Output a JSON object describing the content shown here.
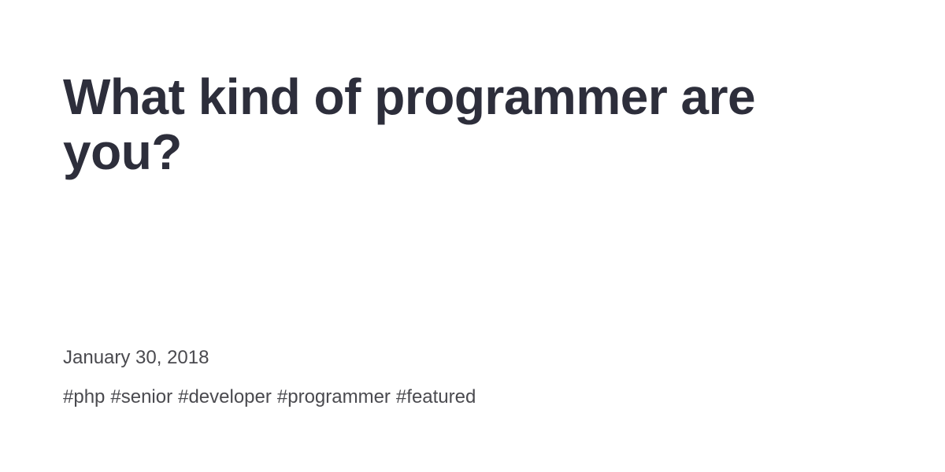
{
  "post": {
    "title": "What kind of programmer are you?",
    "date": "January 30, 2018",
    "tags": [
      "#php",
      "#senior",
      "#developer",
      "#programmer",
      "#featured"
    ]
  },
  "colors": {
    "background": "#ffffff",
    "title": "#2d2e3b",
    "meta": "#4a4a4f"
  }
}
